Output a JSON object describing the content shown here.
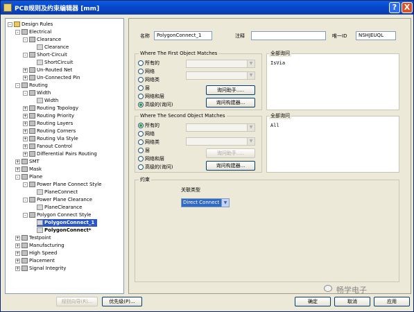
{
  "window": {
    "title": "PCB规则及约束编辑器 [mm]",
    "help_label": "?",
    "close_label": "X"
  },
  "tree": {
    "design_rules": "Design Rules",
    "electrical": "Electrical",
    "clearance": "Clearance",
    "clearance_rule": "Clearance",
    "short_circuit": "Short-Circuit",
    "short_circuit_rule": "ShortCircuit",
    "unrouted_net": "Un-Routed Net",
    "unconnected_pin": "Un-Connected Pin",
    "routing": "Routing",
    "width": "Width",
    "width_rule": "Width",
    "routing_topology": "Routing Topology",
    "routing_priority": "Routing Priority",
    "routing_layers": "Routing Layers",
    "routing_corners": "Routing Corners",
    "routing_via_style": "Routing Via Style",
    "fanout_control": "Fanout Control",
    "diff_pairs_routing": "Differential Pairs Routing",
    "smt": "SMT",
    "mask": "Mask",
    "plane": "Plane",
    "power_plane_connect_style": "Power Plane Connect Style",
    "plane_connect": "PlaneConnect",
    "power_plane_clearance": "Power Plane Clearance",
    "plane_clearance": "PlaneClearance",
    "polygon_connect_style": "Polygon Connect Style",
    "polygon_connect_1": "PolygonConnect_1",
    "polygon_connect": "PolygonConnect*",
    "testpoint": "Testpoint",
    "manufacturing": "Manufacturing",
    "high_speed": "High Speed",
    "placement": "Placement",
    "signal_integrity": "Signal Integrity"
  },
  "rule": {
    "name_label": "名称",
    "name_value": "PolygonConnect_1",
    "comment_label": "注释",
    "comment_value": "",
    "uid_label": "唯一ID",
    "uid_value": "NSHJEUQL"
  },
  "first": {
    "title": "Where The First Object Matches",
    "opt_all": "所有的",
    "opt_net": "网络",
    "opt_netclass": "网络类",
    "opt_layer": "层",
    "opt_net_layer": "网络和层",
    "opt_advanced": "高级的(询问)",
    "helper_button": "询问助手.....",
    "builder_button": "询问构建器...",
    "query_label": "全部询问",
    "query_text": "IsVia"
  },
  "second": {
    "title": "Where The Second Object Matches",
    "opt_all": "所有的",
    "opt_net": "网络",
    "opt_netclass": "网络类",
    "opt_layer": "层",
    "opt_net_layer": "网络和层",
    "opt_advanced": "高级的(询问)",
    "helper_button": "询问助手.....",
    "builder_button": "询问构建器...",
    "query_label": "全部询问",
    "query_text": "All"
  },
  "constraints": {
    "title": "约束",
    "connect_type_label": "关联类型",
    "connect_type_value": "Direct Connect"
  },
  "footer": {
    "rule_wizard": "规则向导(R)...",
    "priorities": "优先级(P)...",
    "ok": "确定",
    "cancel": "取消",
    "apply": "应用"
  },
  "watermark": {
    "text": "畅学电子"
  },
  "colors": {
    "selection": "#2b56c7",
    "titlebar": "#0845c8",
    "radio_on": "#21a121"
  }
}
